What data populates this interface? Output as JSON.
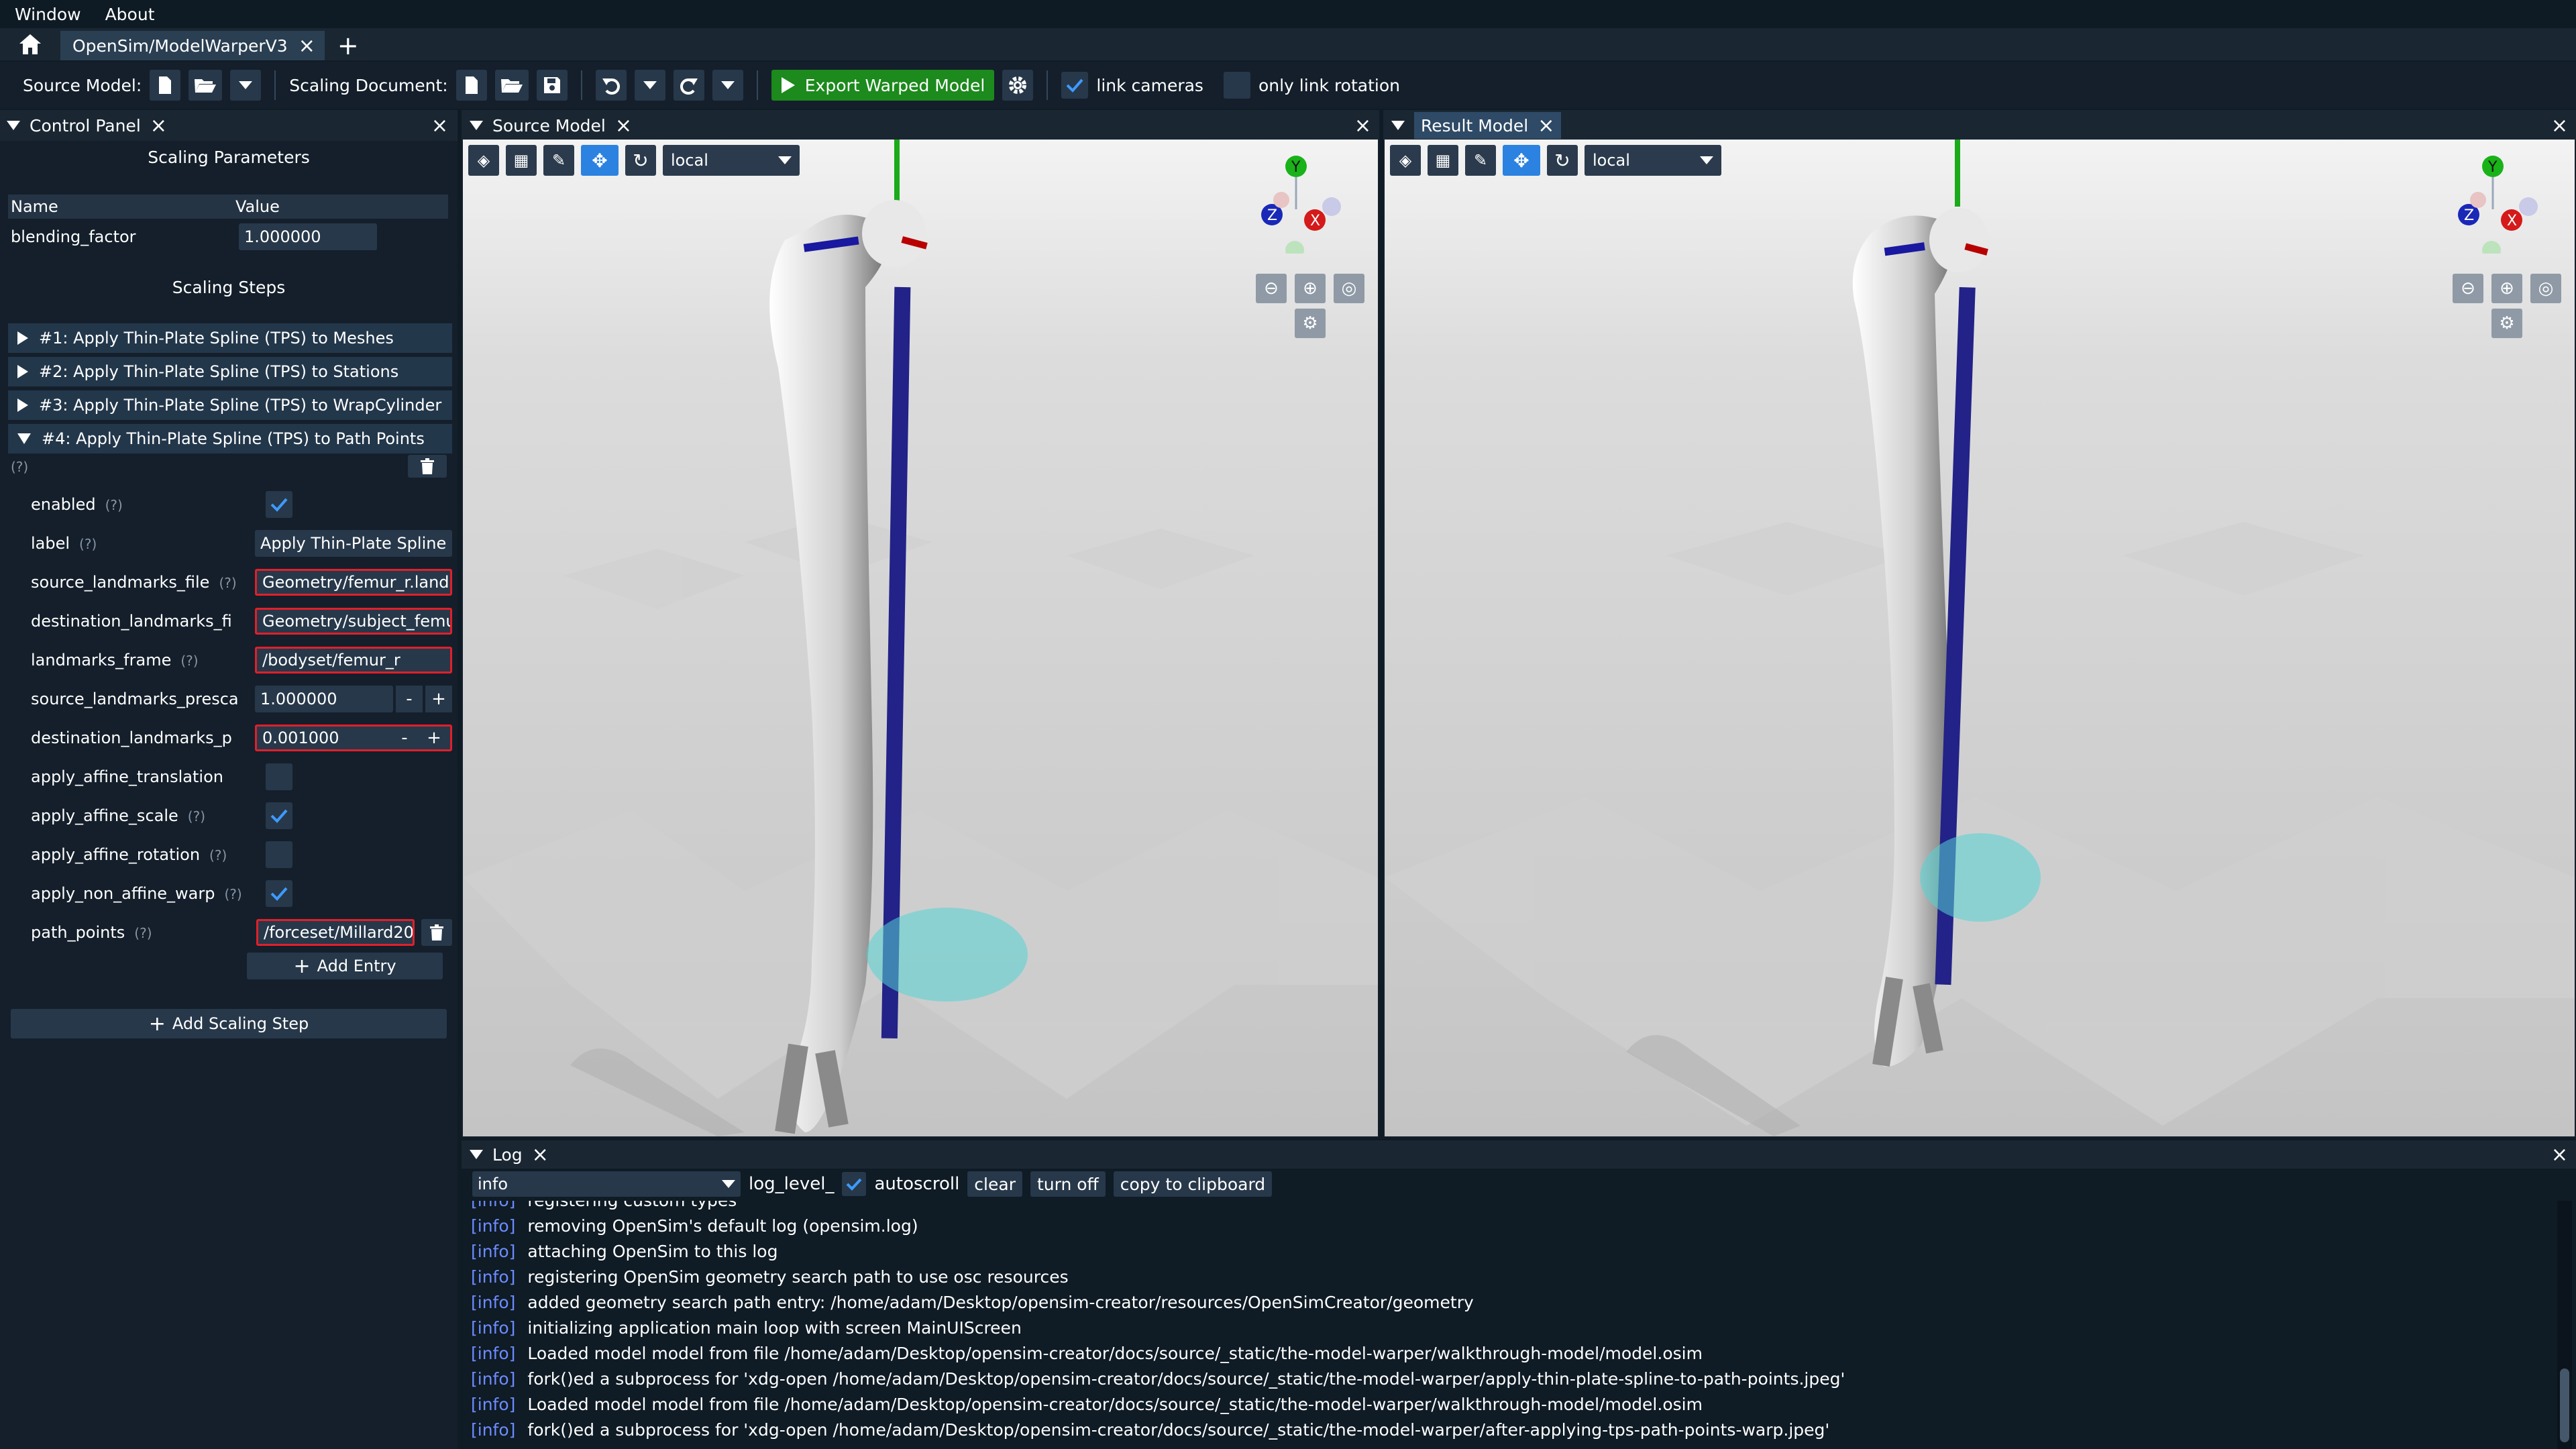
{
  "menu": {
    "window": "Window",
    "about": "About"
  },
  "tabs": {
    "active_label": "OpenSim/ModelWarperV3"
  },
  "toolbar": {
    "source_model_label": "Source Model:",
    "scaling_document_label": "Scaling Document:",
    "export_label": "Export Warped Model",
    "link_cameras_label": "link cameras",
    "only_link_rotation_label": "only link rotation",
    "link_cameras_checked": true,
    "only_link_rotation_checked": false
  },
  "control_panel": {
    "title": "Control Panel",
    "scaling_parameters_title": "Scaling Parameters",
    "col_name": "Name",
    "col_value": "Value",
    "param_name": "blending_factor",
    "param_value": "1.000000",
    "scaling_steps_title": "Scaling Steps",
    "steps": [
      {
        "label": "#1: Apply Thin-Plate Spline (TPS) to Meshes",
        "expanded": false
      },
      {
        "label": "#2: Apply Thin-Plate Spline (TPS) to Stations",
        "expanded": false
      },
      {
        "label": "#3: Apply Thin-Plate Spline (TPS) to WrapCylinder",
        "expanded": false
      },
      {
        "label": "#4: Apply Thin-Plate Spline (TPS) to Path Points",
        "expanded": true
      }
    ],
    "help_mark": "(?)",
    "props": {
      "enabled": "enabled",
      "label": "label",
      "label_value": "Apply Thin-Plate Spline (",
      "src_file": "source_landmarks_file",
      "src_file_value": "Geometry/femur_r.land",
      "dst_file": "destination_landmarks_fi",
      "dst_file_value": "Geometry/subject_femu",
      "frame": "landmarks_frame",
      "frame_value": "/bodyset/femur_r",
      "src_prescale": "source_landmarks_presca",
      "src_prescale_value": "1.000000",
      "dst_prescale": "destination_landmarks_p",
      "dst_prescale_value": "0.001000",
      "aff_trans": "apply_affine_translation",
      "aff_scale": "apply_affine_scale",
      "aff_rot": "apply_affine_rotation",
      "non_affine": "apply_non_affine_warp",
      "path_points": "path_points",
      "path_points_value": "/forceset/Millard20"
    },
    "add_entry": "Add Entry",
    "add_scaling_step": "Add Scaling Step"
  },
  "source_viewport": {
    "title": "Source Model",
    "frame_mode": "local"
  },
  "result_viewport": {
    "title": "Result Model",
    "frame_mode": "local"
  },
  "gizmo": {
    "y": "Y",
    "x": "X",
    "z": "Z"
  },
  "log": {
    "title": "Log",
    "level": "info",
    "level_label": "log_level_",
    "autoscroll": "autoscroll",
    "clear": "clear",
    "turn_off": "turn off",
    "copy": "copy to clipboard",
    "lines": [
      {
        "level": "[info]",
        "text": "registering custom types"
      },
      {
        "level": "[info]",
        "text": "removing OpenSim's default log (opensim.log)"
      },
      {
        "level": "[info]",
        "text": "attaching OpenSim to this log"
      },
      {
        "level": "[info]",
        "text": "registering OpenSim geometry search path to use osc resources"
      },
      {
        "level": "[info]",
        "text": "added geometry search path entry: /home/adam/Desktop/opensim-creator/resources/OpenSimCreator/geometry"
      },
      {
        "level": "[info]",
        "text": "initializing application main loop with screen MainUIScreen"
      },
      {
        "level": "[info]",
        "text": "Loaded model model from file /home/adam/Desktop/opensim-creator/docs/source/_static/the-model-warper/walkthrough-model/model.osim"
      },
      {
        "level": "[info]",
        "text": "fork()ed a subprocess for 'xdg-open /home/adam/Desktop/opensim-creator/docs/source/_static/the-model-warper/apply-thin-plate-spline-to-path-points.jpeg'"
      },
      {
        "level": "[info]",
        "text": "Loaded model model from file /home/adam/Desktop/opensim-creator/docs/source/_static/the-model-warper/walkthrough-model/model.osim"
      },
      {
        "level": "[info]",
        "text": "fork()ed a subprocess for 'xdg-open /home/adam/Desktop/opensim-creator/docs/source/_static/the-model-warper/after-applying-tps-path-points-warp.jpeg'"
      }
    ]
  }
}
